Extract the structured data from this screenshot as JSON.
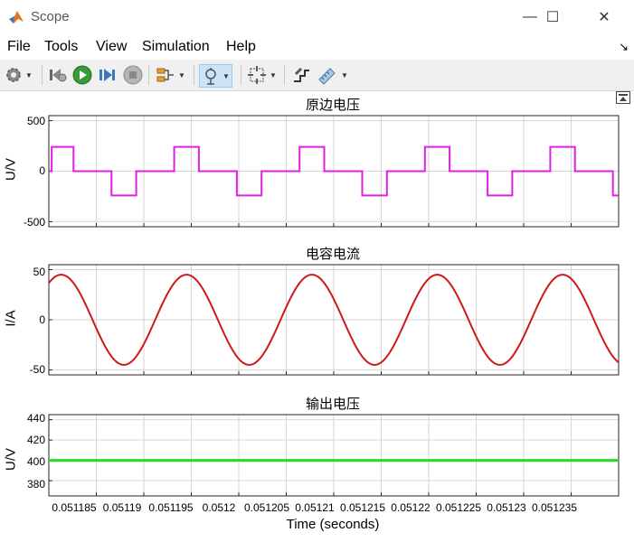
{
  "window": {
    "title": "Scope",
    "minimize": "—",
    "maximize": "☐",
    "close": "✕"
  },
  "menu": {
    "items": [
      "File",
      "Tools",
      "View",
      "Simulation",
      "Help"
    ],
    "dock_arrow": "↘"
  },
  "toolbar": {
    "icons": [
      "gear-icon",
      "step-back-icon",
      "run-icon",
      "step-forward-icon",
      "stop-icon",
      "signal-selector-icon",
      "zoom-icon",
      "fit-to-view-icon",
      "highlight-icon",
      "cursor-measure-icon"
    ]
  },
  "plots": [
    {
      "title": "原边电压",
      "ylabel": "U/V",
      "yticks": [
        "500",
        "0",
        "-500"
      ]
    },
    {
      "title": "电容电流",
      "ylabel": "I/A",
      "yticks": [
        "50",
        "0",
        "-50"
      ]
    },
    {
      "title": "输出电压",
      "ylabel": "U/V",
      "yticks": [
        "440",
        "420",
        "400",
        "380"
      ]
    }
  ],
  "xaxis": {
    "ticks": [
      "0.051185",
      "0.05119",
      "0.051195",
      "0.0512",
      "0.051205",
      "0.05121",
      "0.051215",
      "0.05122",
      "0.051225",
      "0.05123",
      "0.051235"
    ],
    "label": "Time (seconds)"
  },
  "chart_data": [
    {
      "type": "line",
      "title": "原边电压",
      "ylabel": "U/V",
      "xlim": [
        0.05118,
        0.05124
      ],
      "ylim": [
        -550,
        550
      ],
      "grid": true,
      "series": [
        {
          "color": "#e020e0",
          "x": [
            0.05118,
            0.0511803,
            0.0511803,
            0.0511826,
            0.0511826,
            0.0511866,
            0.0511866,
            0.0511892,
            0.0511892,
            0.0511932,
            0.0511932,
            0.0511958,
            0.0511958,
            0.0511998,
            0.0511998,
            0.0512024,
            0.0512024,
            0.0512064,
            0.0512064,
            0.051209,
            0.051209,
            0.051213,
            0.051213,
            0.0512156,
            0.0512156,
            0.0512196,
            0.0512196,
            0.0512222,
            0.0512222,
            0.0512262,
            0.0512262,
            0.0512288,
            0.0512288,
            0.0512328,
            0.0512328,
            0.0512354,
            0.0512354,
            0.0512394,
            0.0512394,
            0.05124
          ],
          "values": [
            0,
            0,
            240,
            240,
            0,
            0,
            -240,
            -240,
            0,
            0,
            240,
            240,
            0,
            0,
            -240,
            -240,
            0,
            0,
            240,
            240,
            0,
            0,
            -240,
            -240,
            0,
            0,
            240,
            240,
            0,
            0,
            -240,
            -240,
            0,
            0,
            240,
            240,
            0,
            0,
            -240,
            -240
          ]
        }
      ]
    },
    {
      "type": "line",
      "title": "电容电流",
      "ylabel": "I/A",
      "xlim": [
        0.05118,
        0.05124
      ],
      "ylim": [
        -55,
        55
      ],
      "grid": true,
      "series": [
        {
          "color": "#d01818",
          "amplitude": 45,
          "period": 1.32e-05,
          "first_peak_x": 0.0511813
        }
      ]
    },
    {
      "type": "line",
      "title": "输出电压",
      "ylabel": "U/V",
      "xlim": [
        0.05118,
        0.05124
      ],
      "ylim": [
        365,
        445
      ],
      "grid": true,
      "series": [
        {
          "color": "#22dd22",
          "x": [
            0.05118,
            0.05124
          ],
          "values": [
            400,
            400
          ]
        }
      ]
    }
  ]
}
